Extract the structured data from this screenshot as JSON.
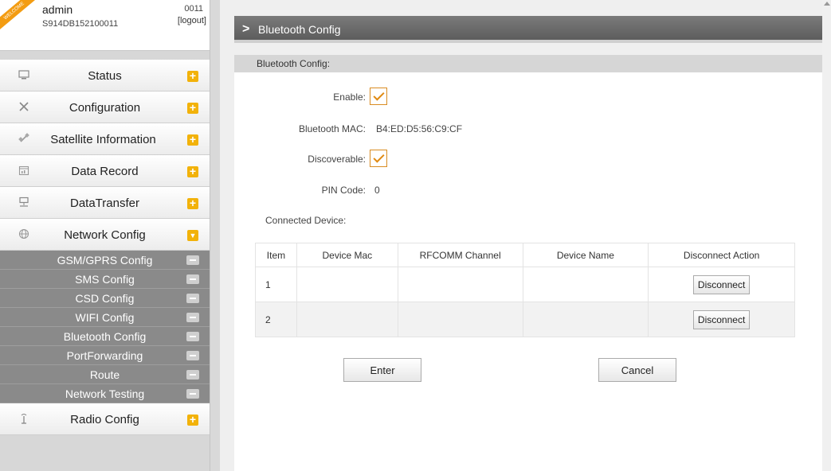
{
  "user": {
    "welcome": "WELCOME",
    "name": "admin",
    "serial": "S914DB152100011",
    "code": "0011",
    "logout": "[logout]"
  },
  "sidebar": {
    "menu_top": [
      {
        "label": "Status",
        "icon": "monitor-icon"
      },
      {
        "label": "Configuration",
        "icon": "tools-icon"
      },
      {
        "label": "Satellite Information",
        "icon": "satellite-icon"
      },
      {
        "label": "Data Record",
        "icon": "calendar-icon"
      },
      {
        "label": "DataTransfer",
        "icon": "network-icon"
      },
      {
        "label": "Network Config",
        "icon": "globe-icon",
        "expanded": true
      }
    ],
    "submenu": [
      {
        "label": "GSM/GPRS Config"
      },
      {
        "label": "SMS Config"
      },
      {
        "label": "CSD Config"
      },
      {
        "label": "WIFI Config"
      },
      {
        "label": "Bluetooth Config"
      },
      {
        "label": "PortForwarding"
      },
      {
        "label": "Route"
      },
      {
        "label": "Network Testing"
      }
    ],
    "menu_bottom": [
      {
        "label": "Radio Config",
        "icon": "antenna-icon"
      }
    ]
  },
  "main": {
    "title": "Bluetooth Config",
    "section_title": "Bluetooth Config:",
    "fields": {
      "enable_label": "Enable:",
      "enable_checked": true,
      "mac_label": "Bluetooth MAC:",
      "mac_value": "B4:ED:D5:56:C9:CF",
      "discoverable_label": "Discoverable:",
      "discoverable_checked": true,
      "pin_label": "PIN Code:",
      "pin_value": "0",
      "connected_label": "Connected Device:"
    },
    "table": {
      "headers": [
        "Item",
        "Device Mac",
        "RFCOMM Channel",
        "Device Name",
        "Disconnect Action"
      ],
      "rows": [
        {
          "item": "1",
          "mac": "",
          "channel": "",
          "name": "",
          "action": "Disconnect"
        },
        {
          "item": "2",
          "mac": "",
          "channel": "",
          "name": "",
          "action": "Disconnect"
        }
      ]
    },
    "buttons": {
      "enter": "Enter",
      "cancel": "Cancel"
    }
  },
  "colors": {
    "accent": "#f2b20a",
    "checkbox_orange": "#e08a12",
    "title_bar": "#6a6a6a",
    "submenu_bg": "#8a8a8a"
  }
}
